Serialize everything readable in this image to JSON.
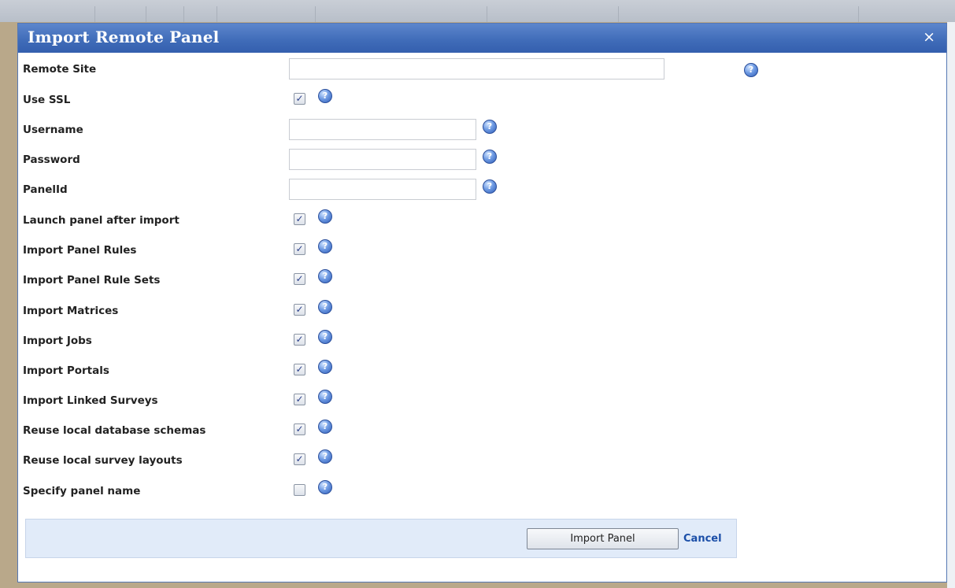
{
  "dialog": {
    "title": "Import Remote Panel",
    "close_glyph": "×"
  },
  "fields": {
    "remote_site": {
      "label": "Remote Site",
      "value": ""
    },
    "use_ssl": {
      "label": "Use SSL",
      "checked": true
    },
    "username": {
      "label": "Username",
      "value": ""
    },
    "password": {
      "label": "Password",
      "value": ""
    },
    "panel_id": {
      "label": "PanelId",
      "value": ""
    }
  },
  "options": [
    {
      "label": "Launch panel after import",
      "checked": true
    },
    {
      "label": "Import Panel Rules",
      "checked": true
    },
    {
      "label": "Import Panel Rule Sets",
      "checked": true
    },
    {
      "label": "Import Matrices",
      "checked": true
    },
    {
      "label": "Import Jobs",
      "checked": true
    },
    {
      "label": "Import Portals",
      "checked": true
    },
    {
      "label": "Import Linked Surveys",
      "checked": true
    },
    {
      "label": "Reuse local database schemas",
      "checked": true
    },
    {
      "label": "Reuse local survey layouts",
      "checked": true
    },
    {
      "label": "Specify panel name",
      "checked": false
    }
  ],
  "icons": {
    "help": "help-icon",
    "help_glyph": "?",
    "check_glyph": "✓",
    "close": "close-icon"
  },
  "footer": {
    "import_button": "Import Panel",
    "cancel_link": "Cancel"
  },
  "colors": {
    "title_bar": "#3f6bb8",
    "footer_bg": "#e1ebf9",
    "link": "#1a4ea8"
  }
}
